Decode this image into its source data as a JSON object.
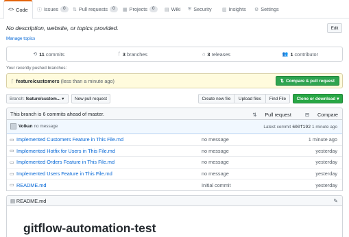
{
  "tabs": [
    {
      "label": "Code",
      "icon": "code-icon",
      "glyph": "<>"
    },
    {
      "label": "Issues",
      "count": "0",
      "icon": "issue-icon",
      "glyph": "ⓘ"
    },
    {
      "label": "Pull requests",
      "count": "0",
      "icon": "pull-request-icon",
      "glyph": "⇅"
    },
    {
      "label": "Projects",
      "count": "0",
      "icon": "project-icon",
      "glyph": "▦"
    },
    {
      "label": "Wiki",
      "icon": "book-icon",
      "glyph": "▤"
    },
    {
      "label": "Security",
      "icon": "shield-icon",
      "glyph": "⛨"
    },
    {
      "label": "Insights",
      "icon": "graph-icon",
      "glyph": "▥"
    },
    {
      "label": "Settings",
      "icon": "gear-icon",
      "glyph": "⚙"
    }
  ],
  "repo": {
    "description": "No description, website, or topics provided.",
    "edit_label": "Edit",
    "manage_topics": "Manage topics"
  },
  "numbers": {
    "commits_count": "11",
    "commits_label": "commits",
    "branches_count": "3",
    "branches_label": "branches",
    "releases_count": "3",
    "releases_label": "releases",
    "contributors_count": "1",
    "contributors_label": "contributor"
  },
  "recent": {
    "heading": "Your recently pushed branches:",
    "branch": "feature/customers",
    "time": "(less than a minute ago)",
    "compare_button": "Compare & pull request"
  },
  "toolbar": {
    "branch_prefix": "Branch:",
    "branch_name": "feature/custom...",
    "caret": "▾",
    "new_pr": "New pull request",
    "create_file": "Create new file",
    "upload_files": "Upload files",
    "find_file": "Find File",
    "clone": "Clone or download"
  },
  "ahead": {
    "text": "This branch is 6 commits ahead of master.",
    "pull_request": "Pull request",
    "compare": "Compare"
  },
  "latest_commit": {
    "author": "Volkan",
    "message": "no message",
    "prefix": "Latest commit",
    "sha": "600f192",
    "time": "1 minute ago"
  },
  "files": [
    {
      "name": "Implemented Customers Feature in This File.md",
      "message": "no message",
      "age": "1 minute ago"
    },
    {
      "name": "Implemented Hotfix for Users in This File.md",
      "message": "no message",
      "age": "yesterday"
    },
    {
      "name": "Implemented Orders Feature in This File.md",
      "message": "no message",
      "age": "yesterday"
    },
    {
      "name": "Implemented Users Feature in This File.md",
      "message": "no message",
      "age": "yesterday"
    },
    {
      "name": "README.md",
      "message": "Initial commit",
      "age": "yesterday"
    }
  ],
  "readme": {
    "filename": "README.md",
    "title": "gitflow-automation-test"
  },
  "colors": {
    "accent_tab": "#e36209",
    "link": "#0366d6",
    "primary_button": "#28a745",
    "push_banner": "#fffbdd"
  }
}
